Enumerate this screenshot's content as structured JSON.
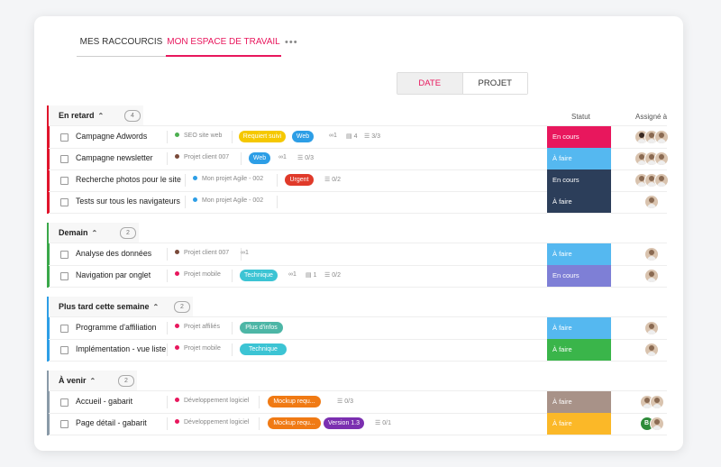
{
  "tabs": [
    {
      "label": "MES RACCOURCIS"
    },
    {
      "label": "MON ESPACE DE TRAVAIL"
    }
  ],
  "more_label": "•••",
  "switch": {
    "date": "DATE",
    "projet": "PROJET"
  },
  "columns": {
    "statut": "Statut",
    "assigne": "Assigné à"
  },
  "colors": {
    "accent": "#e8175d"
  },
  "sections": [
    {
      "title": "En retard",
      "count": "4",
      "color": "#e0152c",
      "tasks": [
        {
          "name": "Campagne Adwords",
          "project": "SEO site web",
          "dot": "#4caf50",
          "tags": [
            {
              "label": "Requiert suivi",
              "color": "#f5c800"
            },
            {
              "label": "Web",
              "color": "#2d9ee6"
            }
          ],
          "links": "1",
          "comments": "4",
          "checklist": "3/3",
          "status": "En cours",
          "status_color": "#e8175d",
          "assignees": [
            "avatar",
            "avatar",
            "avatar"
          ]
        },
        {
          "name": "Campagne newsletter",
          "project": "Projet client 007",
          "dot": "#7a4a3a",
          "tags": [
            {
              "label": "Web",
              "color": "#2d9ee6"
            }
          ],
          "links": "1",
          "comments": "",
          "checklist": "0/3",
          "status": "À faire",
          "status_color": "#55b8f0",
          "assignees": [
            "avatar",
            "avatar",
            "avatar"
          ]
        },
        {
          "name": "Recherche photos pour le site",
          "project": "Mon projet Agile - 002",
          "dot": "#2d9ee6",
          "tags": [
            {
              "label": "Urgent",
              "color": "#e03a2a"
            }
          ],
          "links": "",
          "comments": "",
          "checklist": "0/2",
          "status": "En cours",
          "status_color": "#2c3e5a",
          "assignees": [
            "avatar",
            "avatar",
            "avatar"
          ]
        },
        {
          "name": "Tests sur tous les navigateurs",
          "project": "Mon projet Agile - 002",
          "dot": "#2d9ee6",
          "tags": [],
          "links": "",
          "comments": "",
          "checklist": "",
          "status": "À faire",
          "status_color": "#2c3e5a",
          "assignees": [
            "avatar"
          ]
        }
      ]
    },
    {
      "title": "Demain",
      "count": "2",
      "color": "#3aa84a",
      "tasks": [
        {
          "name": "Analyse des données",
          "project": "Projet client 007",
          "dot": "#7a4a3a",
          "tags": [],
          "links": "1",
          "comments": "",
          "checklist": "",
          "status": "À faire",
          "status_color": "#55b8f0",
          "assignees": [
            "avatar"
          ]
        },
        {
          "name": "Navigation par onglet",
          "project": "Projet mobile",
          "dot": "#e8175d",
          "tags": [
            {
              "label": "Technique",
              "color": "#3cc4d4"
            }
          ],
          "links": "1",
          "comments": "1",
          "checklist": "0/2",
          "status": "En cours",
          "status_color": "#7e7fd6",
          "assignees": [
            "avatar"
          ]
        }
      ]
    },
    {
      "title": "Plus tard cette semaine",
      "count": "2",
      "color": "#2d9ee6",
      "tasks": [
        {
          "name": "Programme d'affiliation",
          "project": "Projet affiliés",
          "dot": "#e8175d",
          "tags": [
            {
              "label": "Plus d'infos",
              "color": "#4db6a6"
            }
          ],
          "links": "",
          "comments": "",
          "checklist": "",
          "status": "À faire",
          "status_color": "#55b8f0",
          "assignees": [
            "avatar"
          ]
        },
        {
          "name": "Implémentation - vue liste",
          "project": "Projet mobile",
          "dot": "#e8175d",
          "tags": [
            {
              "label": "Technique",
              "color": "#3cc4d4"
            }
          ],
          "links": "",
          "comments": "",
          "checklist": "",
          "status": "À faire",
          "status_color": "#3ab54a",
          "assignees": [
            "avatar"
          ]
        }
      ]
    },
    {
      "title": "À venir",
      "count": "2",
      "color": "#8a9aa8",
      "tasks": [
        {
          "name": "Accueil - gabarit",
          "project": "Développement logiciel",
          "dot": "#e8175d",
          "tags": [
            {
              "label": "Mockup requ...",
              "color": "#f07a14"
            }
          ],
          "links": "",
          "comments": "",
          "checklist": "0/3",
          "status": "À faire",
          "status_color": "#a89288",
          "assignees": [
            "avatar",
            "avatar"
          ]
        },
        {
          "name": "Page détail - gabarit",
          "project": "Développement logiciel",
          "dot": "#e8175d",
          "tags": [
            {
              "label": "Mockup requ...",
              "color": "#f07a14"
            },
            {
              "label": "Version 1.3",
              "color": "#7b2fb0"
            }
          ],
          "links": "",
          "comments": "",
          "checklist": "0/1",
          "status": "À faire",
          "status_color": "#fbb828",
          "assignees": [
            "B",
            "avatar"
          ]
        }
      ]
    }
  ]
}
